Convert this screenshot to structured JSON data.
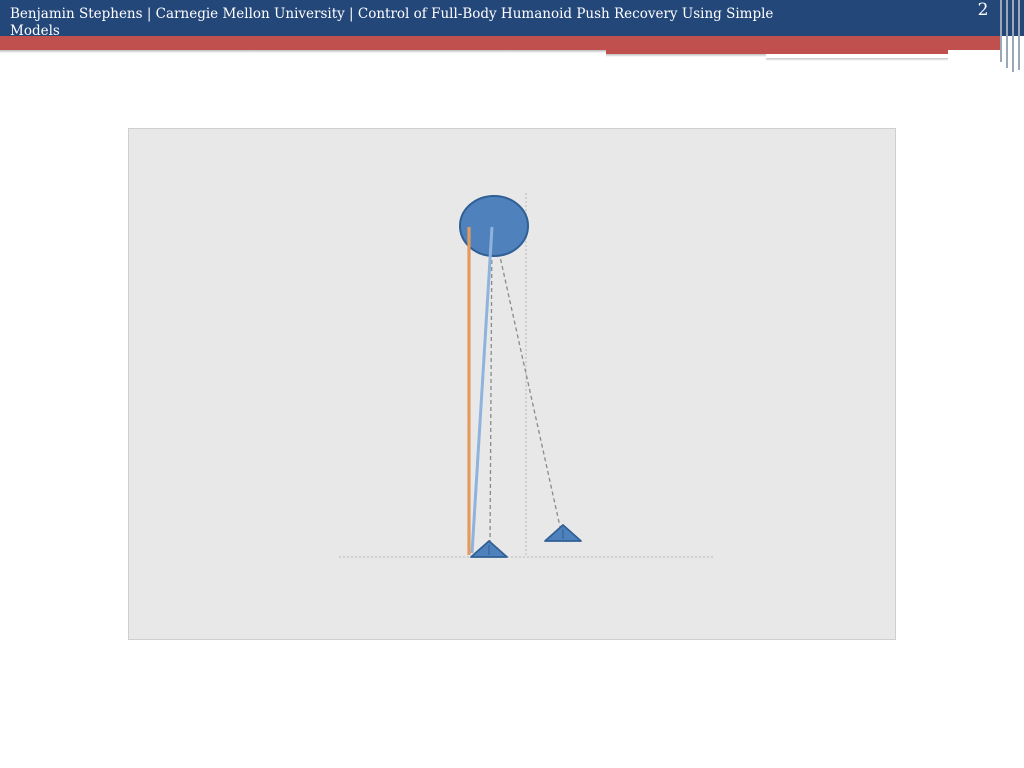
{
  "header": {
    "title": "Benjamin Stephens | Carnegie Mellon University | Control of Full-Body Humanoid Push Recovery Using Simple Models",
    "slide_number": "2"
  },
  "figure": {
    "colors": {
      "background": "#e8e8e8",
      "mass": "#4f81bd",
      "mass_outline": "#2f5f95",
      "orange_leg": "#e39a5a",
      "blue_leg": "#8fb3dd",
      "dashed": "#8a8a8a",
      "guide_lines": "#b8b8b8"
    }
  }
}
